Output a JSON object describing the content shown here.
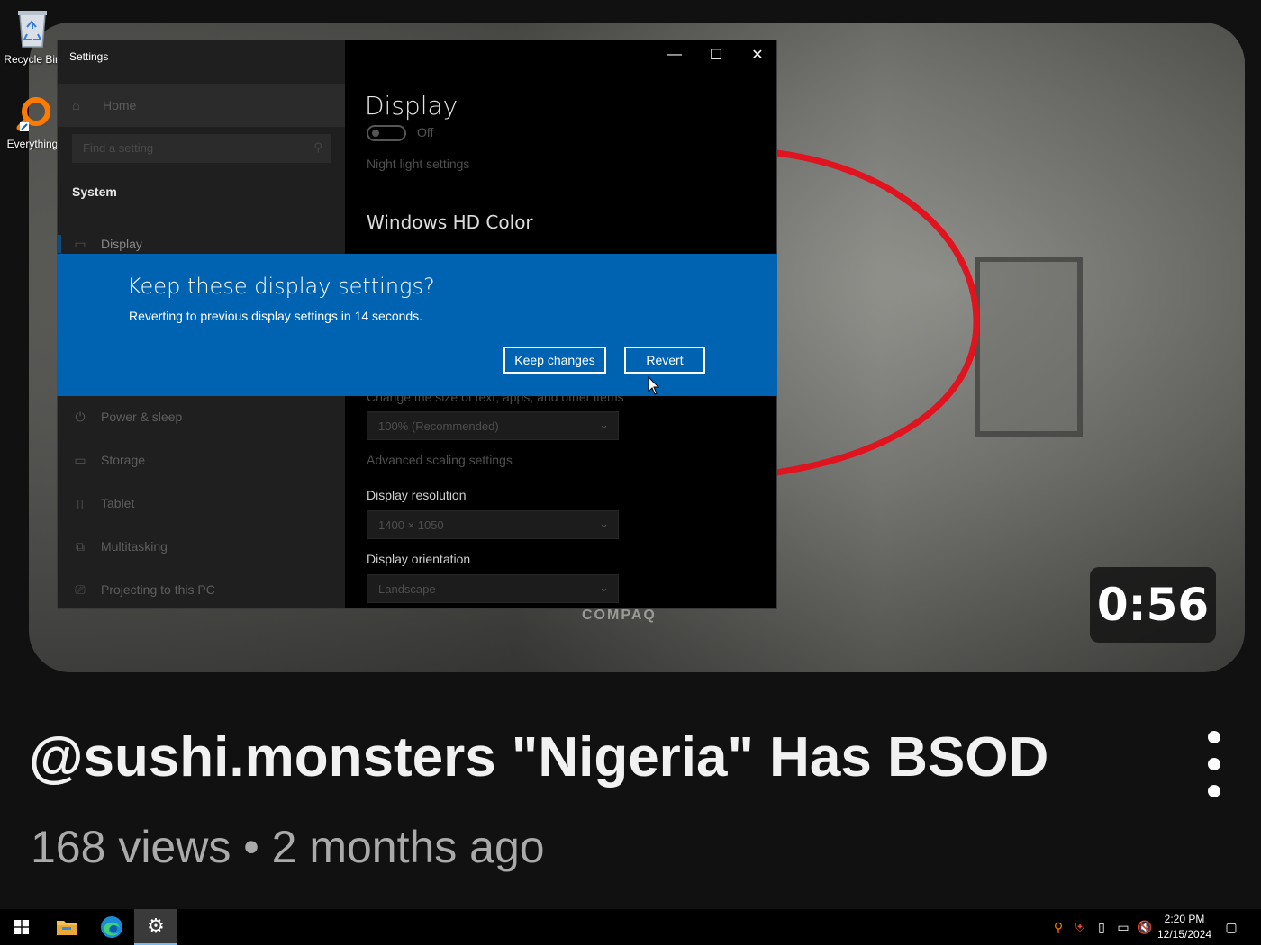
{
  "desktop": {
    "icons": [
      {
        "label": "Recycle Bin",
        "icon": "recycle-bin-icon"
      },
      {
        "label": "Everything",
        "icon": "everything-search-icon"
      }
    ]
  },
  "video": {
    "timestamp": "0:56",
    "monitor_brand": "COMPAQ",
    "title": "@sushi.monsters \"Nigeria\" Has BSOD",
    "meta": "168 views • 2 months ago",
    "highlight_color": "#e0131e"
  },
  "settings": {
    "window_title": "Settings",
    "controls": {
      "minimize": "—",
      "maximize": "☐",
      "close": "✕"
    },
    "sidebar": {
      "home": "Home",
      "search_placeholder": "Find a setting",
      "section": "System",
      "items": [
        {
          "label": "Display",
          "icon": "monitor-icon"
        },
        {
          "label": "Power & sleep",
          "icon": "power-icon"
        },
        {
          "label": "Storage",
          "icon": "storage-icon"
        },
        {
          "label": "Tablet",
          "icon": "tablet-icon"
        },
        {
          "label": "Multitasking",
          "icon": "multitasking-icon"
        },
        {
          "label": "Projecting to this PC",
          "icon": "projecting-icon"
        }
      ]
    },
    "content": {
      "title": "Display",
      "night_light_state": "Off",
      "night_light_link": "Night light settings",
      "hd_color_heading": "Windows HD Color",
      "scale_label": "Change the size of text, apps, and other items",
      "scale_value": "100% (Recommended)",
      "advanced_scaling_link": "Advanced scaling settings",
      "resolution_label": "Display resolution",
      "resolution_value": "1400 × 1050",
      "orientation_label": "Display orientation",
      "orientation_value": "Landscape"
    }
  },
  "dialog": {
    "title": "Keep these display settings?",
    "body": "Reverting to previous display settings in 14 seconds.",
    "keep_label": "Keep changes",
    "revert_label": "Revert",
    "color": "#0063b1"
  },
  "taskbar": {
    "items": [
      "start-button",
      "file-explorer",
      "edge",
      "settings"
    ],
    "time": "2:20 PM",
    "date": "12/15/2024"
  }
}
